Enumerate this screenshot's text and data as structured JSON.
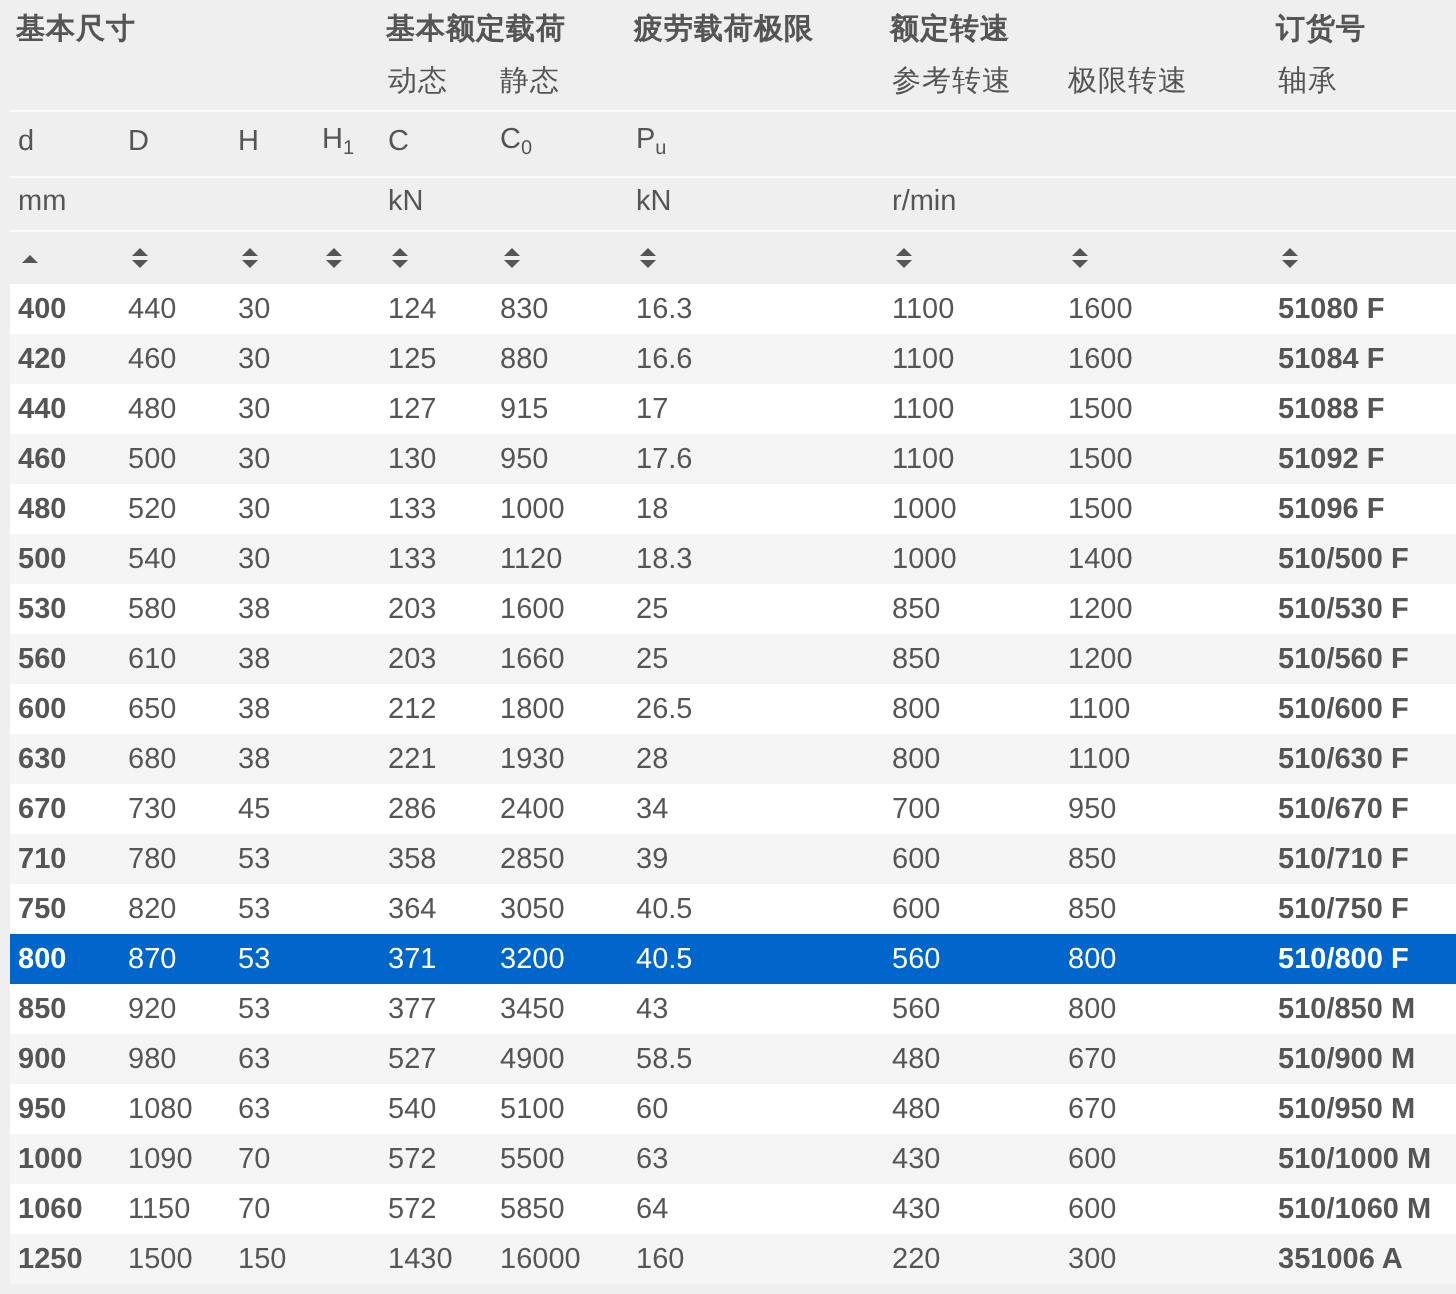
{
  "table": {
    "groups": [
      {
        "label": "基本尺寸",
        "columns": [
          {
            "symbol": "d",
            "unit": "mm",
            "sorted": true
          },
          {
            "symbol": "D",
            "sorted": false
          },
          {
            "symbol": "H",
            "sorted": false
          },
          {
            "symbol": "H$_{1}$",
            "sorted": false
          }
        ]
      },
      {
        "label": "基本额定载荷",
        "columns": [
          {
            "sublabel": "动态",
            "symbol": "C",
            "unit": "kN",
            "sorted": false
          },
          {
            "sublabel": "静态",
            "symbol": "C$_{0}$",
            "sorted": false
          }
        ]
      },
      {
        "label": "疲劳载荷极限",
        "columns": [
          {
            "symbol": "P$_{u}$",
            "unit": "kN",
            "sorted": false
          }
        ]
      },
      {
        "label": "额定转速",
        "columns": [
          {
            "sublabel": "参考转速",
            "unit": "r/min",
            "sorted": false
          },
          {
            "sublabel": "极限转速",
            "sorted": false
          }
        ]
      },
      {
        "label": "订货号",
        "columns": [
          {
            "sublabel": "轴承",
            "sorted": false
          }
        ]
      }
    ],
    "rows": [
      {
        "selected": false,
        "cells": [
          "400",
          "440",
          "30",
          null,
          "124",
          "830",
          "16.3",
          "1100",
          "1600",
          "51080 F"
        ]
      },
      {
        "selected": false,
        "cells": [
          "420",
          "460",
          "30",
          null,
          "125",
          "880",
          "16.6",
          "1100",
          "1600",
          "51084 F"
        ]
      },
      {
        "selected": false,
        "cells": [
          "440",
          "480",
          "30",
          null,
          "127",
          "915",
          "17",
          "1100",
          "1500",
          "51088 F"
        ]
      },
      {
        "selected": false,
        "cells": [
          "460",
          "500",
          "30",
          null,
          "130",
          "950",
          "17.6",
          "1100",
          "1500",
          "51092 F"
        ]
      },
      {
        "selected": false,
        "cells": [
          "480",
          "520",
          "30",
          null,
          "133",
          "1000",
          "18",
          "1000",
          "1500",
          "51096 F"
        ]
      },
      {
        "selected": false,
        "cells": [
          "500",
          "540",
          "30",
          null,
          "133",
          "1120",
          "18.3",
          "1000",
          "1400",
          "510/500 F"
        ]
      },
      {
        "selected": false,
        "cells": [
          "530",
          "580",
          "38",
          null,
          "203",
          "1600",
          "25",
          "850",
          "1200",
          "510/530 F"
        ]
      },
      {
        "selected": false,
        "cells": [
          "560",
          "610",
          "38",
          null,
          "203",
          "1660",
          "25",
          "850",
          "1200",
          "510/560 F"
        ]
      },
      {
        "selected": false,
        "cells": [
          "600",
          "650",
          "38",
          null,
          "212",
          "1800",
          "26.5",
          "800",
          "1100",
          "510/600 F"
        ]
      },
      {
        "selected": false,
        "cells": [
          "630",
          "680",
          "38",
          null,
          "221",
          "1930",
          "28",
          "800",
          "1100",
          "510/630 F"
        ]
      },
      {
        "selected": false,
        "cells": [
          "670",
          "730",
          "45",
          null,
          "286",
          "2400",
          "34",
          "700",
          "950",
          "510/670 F"
        ]
      },
      {
        "selected": false,
        "cells": [
          "710",
          "780",
          "53",
          null,
          "358",
          "2850",
          "39",
          "600",
          "850",
          "510/710 F"
        ]
      },
      {
        "selected": false,
        "cells": [
          "750",
          "820",
          "53",
          null,
          "364",
          "3050",
          "40.5",
          "600",
          "850",
          "510/750 F"
        ]
      },
      {
        "selected": true,
        "cells": [
          "800",
          "870",
          "53",
          null,
          "371",
          "3200",
          "40.5",
          "560",
          "800",
          "510/800 F"
        ]
      },
      {
        "selected": false,
        "cells": [
          "850",
          "920",
          "53",
          null,
          "377",
          "3450",
          "43",
          "560",
          "800",
          "510/850 M"
        ]
      },
      {
        "selected": false,
        "cells": [
          "900",
          "980",
          "63",
          null,
          "527",
          "4900",
          "58.5",
          "480",
          "670",
          "510/900 M"
        ]
      },
      {
        "selected": false,
        "cells": [
          "950",
          "1080",
          "63",
          null,
          "540",
          "5100",
          "60",
          "480",
          "670",
          "510/950 M"
        ]
      },
      {
        "selected": false,
        "cells": [
          "1000",
          "1090",
          "70",
          null,
          "572",
          "5500",
          "63",
          "430",
          "600",
          "510/1000 M"
        ]
      },
      {
        "selected": false,
        "cells": [
          "1060",
          "1150",
          "70",
          null,
          "572",
          "5850",
          "64",
          "430",
          "600",
          "510/1060 M"
        ]
      },
      {
        "selected": false,
        "cells": [
          "1250",
          "1500",
          "150",
          null,
          "1430",
          "16000",
          "160",
          "220",
          "300",
          "351006 A"
        ]
      }
    ]
  }
}
